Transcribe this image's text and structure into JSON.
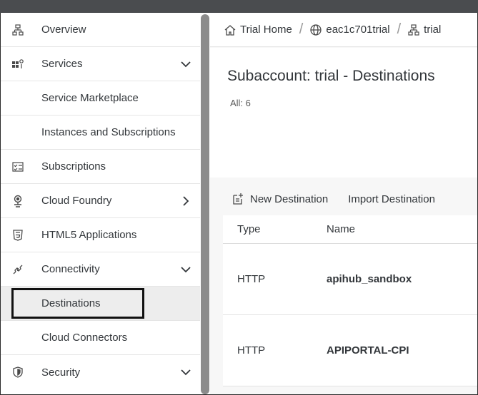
{
  "sidebar": {
    "items": [
      {
        "label": "Overview",
        "icon": "hierarchy-icon"
      },
      {
        "label": "Services",
        "icon": "services-icon",
        "chevron": "down"
      },
      {
        "label": "Service Marketplace"
      },
      {
        "label": "Instances and Subscriptions"
      },
      {
        "label": "Subscriptions",
        "icon": "checklist-icon"
      },
      {
        "label": "Cloud Foundry",
        "icon": "cloud-foundry-icon",
        "chevron": "right"
      },
      {
        "label": "HTML5 Applications",
        "icon": "html5-icon"
      },
      {
        "label": "Connectivity",
        "icon": "connectivity-icon",
        "chevron": "down"
      },
      {
        "label": "Destinations"
      },
      {
        "label": "Cloud Connectors"
      },
      {
        "label": "Security",
        "icon": "shield-icon",
        "chevron": "down"
      }
    ]
  },
  "breadcrumb": {
    "items": [
      {
        "label": "Trial Home",
        "icon": "home-icon"
      },
      {
        "label": "eac1c701trial",
        "icon": "globe-icon"
      },
      {
        "label": "trial",
        "icon": "hierarchy-icon"
      }
    ]
  },
  "header": {
    "title": "Subaccount: trial - Destinations",
    "count": "All: 6"
  },
  "toolbar": {
    "new_destination": "New Destination",
    "import_destination": "Import Destination"
  },
  "table": {
    "columns": [
      "Type",
      "Name"
    ],
    "rows": [
      {
        "type": "HTTP",
        "name": "apihub_sandbox"
      },
      {
        "type": "HTTP",
        "name": "APIPORTAL-CPI"
      }
    ]
  }
}
